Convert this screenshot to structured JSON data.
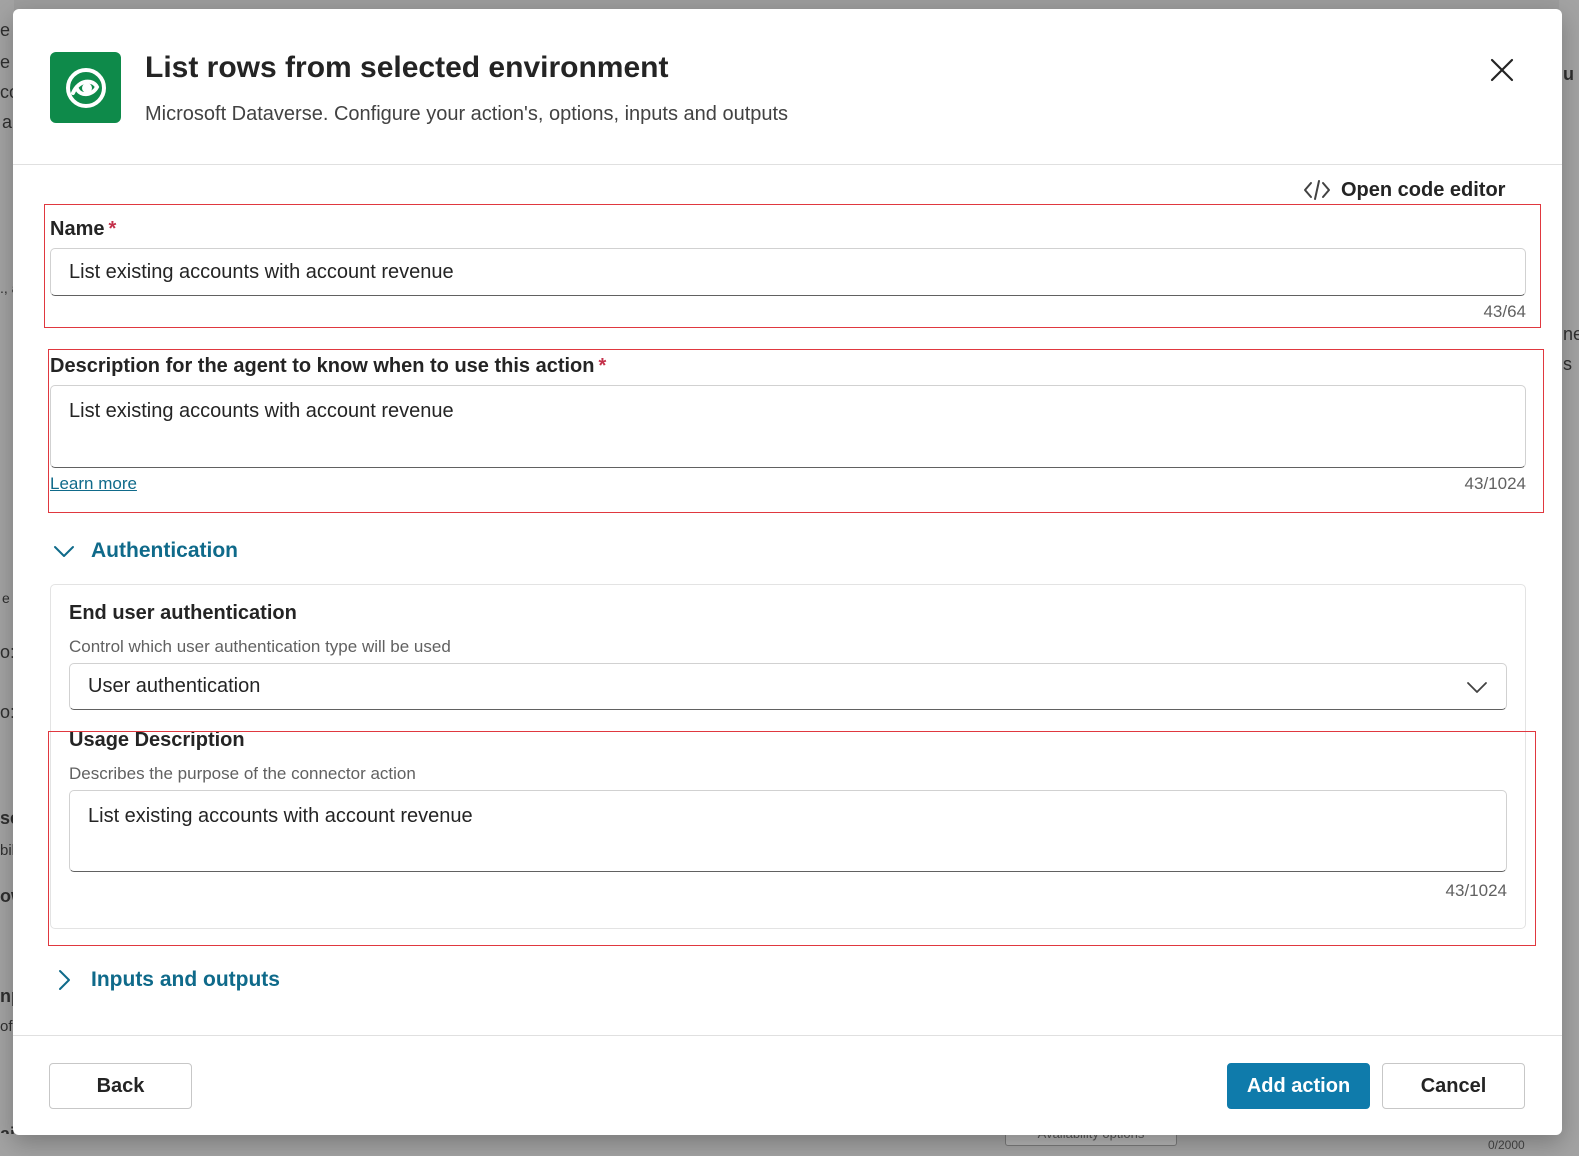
{
  "dialog": {
    "title": "List rows from selected environment",
    "subtitle": "Microsoft Dataverse. Configure your action's, options, inputs and outputs",
    "app_icon": "dataverse-icon",
    "close_icon": "close-icon"
  },
  "toolbar": {
    "code_editor_label": "Open code editor",
    "code_editor_icon": "code-icon"
  },
  "name_field": {
    "label": "Name",
    "required_mark": "*",
    "value": "List existing accounts with account revenue",
    "counter": "43/64"
  },
  "description_field": {
    "label": "Description for the agent to know when to use this action",
    "required_mark": "*",
    "value": "List existing accounts with account revenue",
    "learn_more": "Learn more",
    "counter": "43/1024"
  },
  "authentication": {
    "section_label": "Authentication",
    "expanded": true,
    "end_user_title": "End user authentication",
    "end_user_desc": "Control which user authentication type will be used",
    "selected_value": "User authentication",
    "usage_title": "Usage Description",
    "usage_desc": "Describes the purpose of the connector action",
    "usage_value": "List existing accounts with account revenue",
    "usage_counter": "43/1024"
  },
  "inputs_outputs": {
    "section_label": "Inputs and outputs",
    "expanded": false
  },
  "footer": {
    "back_label": "Back",
    "add_label": "Add action",
    "cancel_label": "Cancel"
  },
  "background": {
    "left_fragments": [
      "e u",
      "e",
      "co",
      "a",
      "., a",
      "e",
      "o:",
      "o:",
      "se",
      "bil",
      "ow",
      "np",
      "of",
      "ails"
    ],
    "right_fragments": [
      "u",
      "ne",
      "s",
      "0/2000"
    ],
    "bottom_button": "Availability options"
  },
  "colors": {
    "accent": "#0f7bab",
    "link": "#0f6a8a",
    "highlight": "#e0383f",
    "app_icon_bg": "#0e8a4a",
    "required": "#c4314b"
  }
}
